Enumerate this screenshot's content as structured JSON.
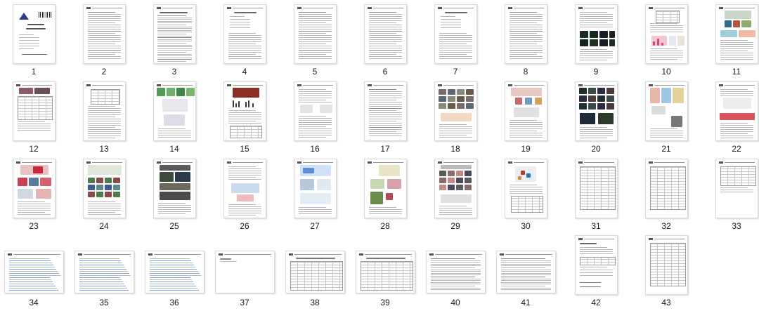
{
  "window": {
    "view": "page-thumbnails"
  },
  "pages": [
    {
      "label": "1",
      "orientation": "portrait",
      "kind": "cover"
    },
    {
      "label": "2",
      "orientation": "portrait",
      "kind": "text"
    },
    {
      "label": "3",
      "orientation": "portrait",
      "kind": "text-dense"
    },
    {
      "label": "4",
      "orientation": "portrait",
      "kind": "text-list"
    },
    {
      "label": "5",
      "orientation": "portrait",
      "kind": "text"
    },
    {
      "label": "6",
      "orientation": "portrait",
      "kind": "text"
    },
    {
      "label": "7",
      "orientation": "portrait",
      "kind": "text-list"
    },
    {
      "label": "8",
      "orientation": "portrait",
      "kind": "text"
    },
    {
      "label": "9",
      "orientation": "portrait",
      "kind": "figure-dark"
    },
    {
      "label": "10",
      "orientation": "portrait",
      "kind": "figure-table-chart"
    },
    {
      "label": "11",
      "orientation": "portrait",
      "kind": "figure-multi"
    },
    {
      "label": "12",
      "orientation": "portrait",
      "kind": "figure-photo-table"
    },
    {
      "label": "13",
      "orientation": "portrait",
      "kind": "table-text"
    },
    {
      "label": "14",
      "orientation": "portrait",
      "kind": "figure-green"
    },
    {
      "label": "15",
      "orientation": "portrait",
      "kind": "figure-red-chart"
    },
    {
      "label": "16",
      "orientation": "portrait",
      "kind": "text-figure"
    },
    {
      "label": "17",
      "orientation": "portrait",
      "kind": "text"
    },
    {
      "label": "18",
      "orientation": "portrait",
      "kind": "figure-grid"
    },
    {
      "label": "19",
      "orientation": "portrait",
      "kind": "figure-diagram"
    },
    {
      "label": "20",
      "orientation": "portrait",
      "kind": "figure-dark-grid"
    },
    {
      "label": "21",
      "orientation": "portrait",
      "kind": "figure-mixed"
    },
    {
      "label": "22",
      "orientation": "portrait",
      "kind": "figure-red-strip"
    },
    {
      "label": "23",
      "orientation": "portrait",
      "kind": "figure-red-map"
    },
    {
      "label": "24",
      "orientation": "portrait",
      "kind": "figure-color-grid"
    },
    {
      "label": "25",
      "orientation": "portrait",
      "kind": "figure-dark-panels"
    },
    {
      "label": "26",
      "orientation": "portrait",
      "kind": "text-figure-small"
    },
    {
      "label": "27",
      "orientation": "portrait",
      "kind": "figure-blue"
    },
    {
      "label": "28",
      "orientation": "portrait",
      "kind": "figure-scatter"
    },
    {
      "label": "29",
      "orientation": "portrait",
      "kind": "figure-photo-grid"
    },
    {
      "label": "30",
      "orientation": "portrait",
      "kind": "figure-network"
    },
    {
      "label": "31",
      "orientation": "portrait",
      "kind": "table"
    },
    {
      "label": "32",
      "orientation": "portrait",
      "kind": "table"
    },
    {
      "label": "33",
      "orientation": "portrait",
      "kind": "table-sparse"
    },
    {
      "label": "34",
      "orientation": "landscape",
      "kind": "text-blue"
    },
    {
      "label": "35",
      "orientation": "landscape",
      "kind": "text-blue"
    },
    {
      "label": "36",
      "orientation": "landscape",
      "kind": "text-blue"
    },
    {
      "label": "37",
      "orientation": "landscape",
      "kind": "blank"
    },
    {
      "label": "38",
      "orientation": "landscape",
      "kind": "table-wide"
    },
    {
      "label": "39",
      "orientation": "landscape",
      "kind": "table-wide"
    },
    {
      "label": "40",
      "orientation": "landscape",
      "kind": "text-wide"
    },
    {
      "label": "41",
      "orientation": "landscape",
      "kind": "text-wide"
    },
    {
      "label": "42",
      "orientation": "portrait",
      "kind": "form"
    },
    {
      "label": "43",
      "orientation": "portrait",
      "kind": "table"
    }
  ],
  "colors": {
    "accent_selection": "#3a7bd5",
    "cover_logo": "#2a3d8f",
    "link_blue": "#5b8fd6",
    "caption": "#1a1a1a"
  }
}
